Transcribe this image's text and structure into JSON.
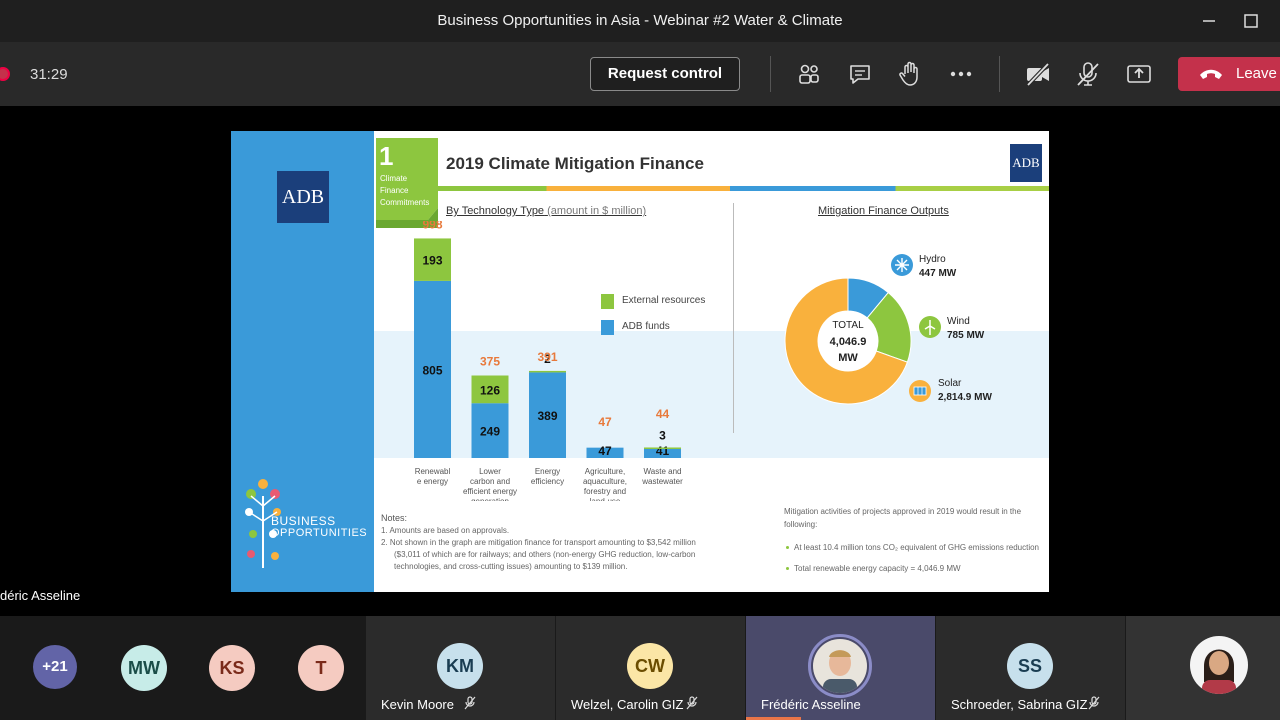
{
  "window": {
    "title": "Business Opportunities in Asia - Webinar #2 Water & Climate"
  },
  "toolbar": {
    "timer": "31:29",
    "request_control": "Request control",
    "leave": "Leave"
  },
  "slide": {
    "step_number": "1",
    "step_label_1": "Climate",
    "step_label_2": "Finance",
    "step_label_3": "Commitments",
    "title": "2019 Climate Mitigation Finance",
    "logo_text": "ADB",
    "left_heading": "By Technology Type",
    "left_heading_sub": "(amount in $ million)",
    "right_heading": "Mitigation Finance Outputs",
    "business_1": "BUSINESS",
    "business_2": "OPPORTUNITIES",
    "notes": {
      "heading": "Notes:",
      "n1": "1.   Amounts are based on approvals.",
      "n2a": "2.   Not shown in the graph are mitigation finance for transport amounting to $3,542 million",
      "n2b": "($3,011 of which are for railways; and others (non-energy GHG reduction, low-carbon",
      "n2c": "technologies, and cross-cutting issues) amounting to $139 million."
    },
    "summary": {
      "line1": "Mitigation activities of projects approved in 2019 would result in the",
      "line2": "following:",
      "b1": "At least 10.4 million tons CO₂ equivalent of GHG emissions reduction",
      "b2": "Total renewable energy capacity = 4,046.9 MW"
    }
  },
  "chart_data": [
    {
      "type": "bar",
      "categories": [
        "Renewable energy",
        "Lower carbon and efficient energy generation",
        "Energy efficiency",
        "Agriculture, aquaculture, forestry and land-use",
        "Waste and wastewater"
      ],
      "category_lines": [
        [
          "Renewabl",
          "e energy"
        ],
        [
          "Lower",
          "carbon and",
          "efficient energy",
          "generation"
        ],
        [
          "Energy",
          "efficiency"
        ],
        [
          "Agriculture,",
          "aquaculture,",
          "forestry and",
          "land-use"
        ],
        [
          "Waste and",
          "wastewater"
        ]
      ],
      "series": [
        {
          "name": "ADB funds",
          "values": [
            805,
            249,
            389,
            47,
            41
          ],
          "color": "#3a9ad9"
        },
        {
          "name": "External resources",
          "values": [
            193,
            126,
            2,
            0,
            3
          ],
          "color": "#8dc63f"
        }
      ],
      "totals": [
        998,
        375,
        391,
        47,
        44
      ],
      "segment_labels": [
        [
          "805",
          "193"
        ],
        [
          "249",
          "126"
        ],
        [
          "389",
          "2"
        ],
        [
          "47",
          ""
        ],
        [
          "41",
          "3"
        ]
      ],
      "ylim": [
        0,
        1000
      ],
      "legend": [
        "External resources",
        "ADB funds"
      ]
    },
    {
      "type": "pie",
      "slices": [
        {
          "name": "Hydro",
          "value_label": "447 MW",
          "value": 447,
          "color": "#3a9ad9"
        },
        {
          "name": "Wind",
          "value_label": "785 MW",
          "value": 785,
          "color": "#8dc63f"
        },
        {
          "name": "Solar",
          "value_label": "2,814.9 MW",
          "value": 2814.9,
          "color": "#f9b13d"
        }
      ],
      "center_1": "TOTAL",
      "center_2": "4,046.9",
      "center_3": "MW"
    }
  ],
  "presenter_name": "déric Asseline",
  "participants": {
    "more": "+21",
    "p1": {
      "initials": "MW",
      "bg": "#c7ece8",
      "fg": "#1a4d48"
    },
    "p2": {
      "initials": "KS",
      "bg": "#f5cbc1",
      "fg": "#7a2a1a"
    },
    "p3": {
      "initials": "T",
      "bg": "#f5cbc1",
      "fg": "#7a2a1a"
    },
    "t1": {
      "initials": "KM",
      "name": "Kevin Moore"
    },
    "t2": {
      "initials": "CW",
      "name": "Welzel, Carolin GIZ"
    },
    "t3": {
      "name": "Frédéric Asseline"
    },
    "t4": {
      "initials": "SS",
      "name": "Schroeder, Sabrina GIZ"
    }
  }
}
